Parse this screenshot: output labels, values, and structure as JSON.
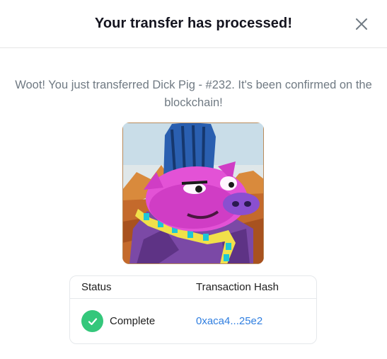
{
  "modal": {
    "title": "Your transfer has processed!",
    "close_icon": "close-icon",
    "message": "Woot! You just transferred Dick Pig - #232. It's been confirmed on the blockchain!"
  },
  "nft": {
    "image_icon": "pixel-art-pig-image"
  },
  "table": {
    "headers": {
      "status": "Status",
      "hash": "Transaction Hash"
    },
    "row": {
      "status": "Complete",
      "status_icon": "check-circle-icon",
      "hash": "0xaca4...25e2"
    }
  },
  "colors": {
    "title": "#14141f",
    "message": "#707a83",
    "success": "#34c77b",
    "link": "#2f7ee0",
    "border": "#e5e8eb"
  }
}
